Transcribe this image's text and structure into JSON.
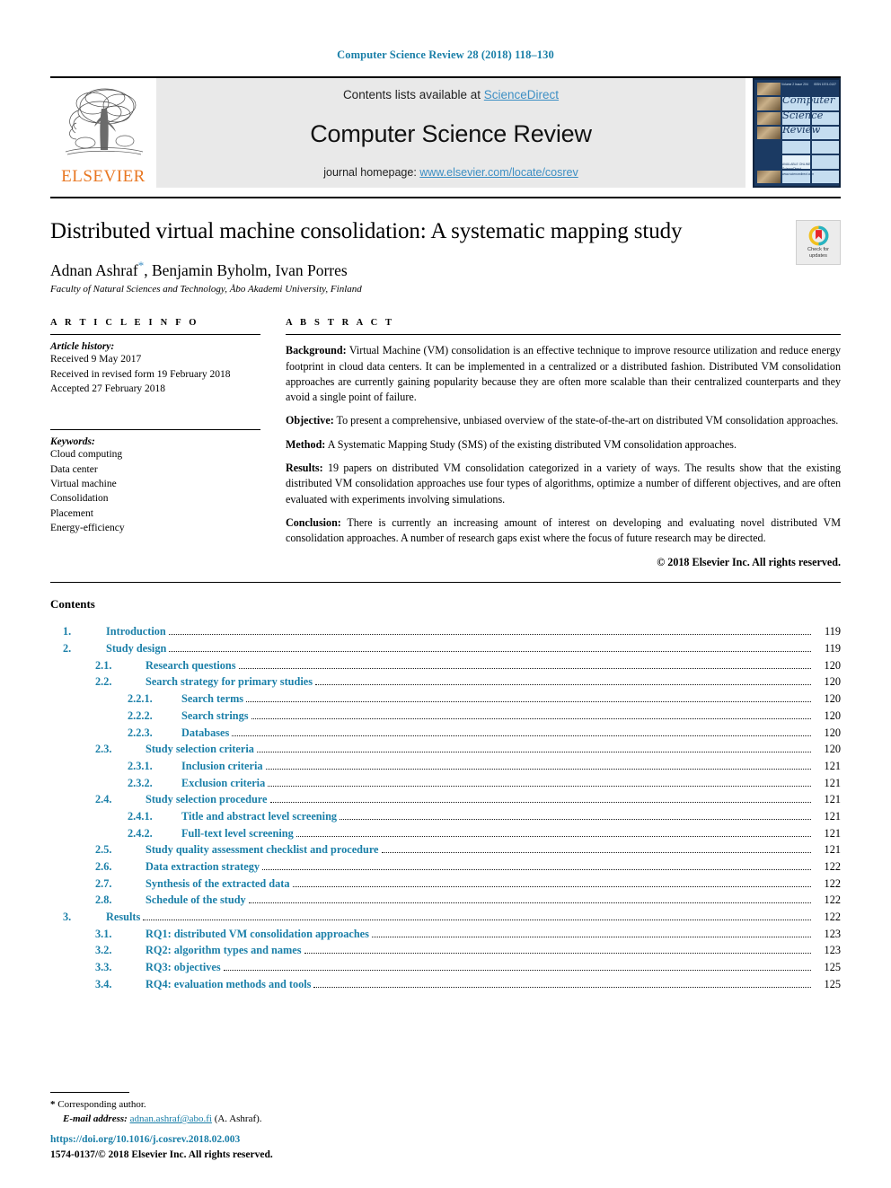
{
  "running_head": "Computer Science Review 28 (2018) 118–130",
  "masthead": {
    "publisher_wordmark": "ELSEVIER",
    "contents_prefix": "Contents lists available at ",
    "contents_link": "ScienceDirect",
    "journal_title": "Computer Science Review",
    "homepage_prefix": "journal homepage: ",
    "homepage_link": "www.elsevier.com/locate/cosrev",
    "cover": {
      "line1": "Computer",
      "line2": "Science",
      "line3": "Review",
      "top_left": "Volume 2  Issue 204",
      "top_right": "ISSN 1574-0137",
      "foot1": "AVAILABLE ONLINE",
      "foot2": "ScienceDirect",
      "foot3": "www.sciencedirect.com"
    }
  },
  "article": {
    "title": "Distributed virtual machine consolidation: A systematic mapping study",
    "authors": "Adnan Ashraf",
    "authors_rest": ", Benjamin Byholm, Ivan Porres",
    "affiliation": "Faculty of Natural Sciences and Technology, Åbo Akademi University, Finland",
    "crossmark_line1": "Check for",
    "crossmark_line2": "updates"
  },
  "article_info": {
    "heading": "A R T I C L E   I N F O",
    "history_label": "Article history:",
    "history": [
      "Received 9 May 2017",
      "Received in revised form 19 February 2018",
      "Accepted 27 February 2018"
    ],
    "keywords_label": "Keywords:",
    "keywords": [
      "Cloud computing",
      "Data center",
      "Virtual machine",
      "Consolidation",
      "Placement",
      "Energy-efficiency"
    ]
  },
  "abstract": {
    "heading": "A B S T R A C T",
    "paragraphs": [
      {
        "lead": "Background:",
        "text": " Virtual Machine (VM) consolidation is an effective technique to improve resource utilization and reduce energy footprint in cloud data centers. It can be implemented in a centralized or a distributed fashion. Distributed VM consolidation approaches are currently gaining popularity because they are often more scalable than their centralized counterparts and they avoid a single point of failure."
      },
      {
        "lead": "Objective:",
        "text": " To present a comprehensive, unbiased overview of the state-of-the-art on distributed VM consolidation approaches."
      },
      {
        "lead": "Method:",
        "text": " A Systematic Mapping Study (SMS) of the existing distributed VM consolidation approaches."
      },
      {
        "lead": "Results:",
        "text": " 19 papers on distributed VM consolidation categorized in a variety of ways. The results show that the existing distributed VM consolidation approaches use four types of algorithms, optimize a number of different objectives, and are often evaluated with experiments involving simulations."
      },
      {
        "lead": "Conclusion:",
        "text": " There is currently an increasing amount of interest on developing and evaluating novel distributed VM consolidation approaches. A number of research gaps exist where the focus of future research may be directed."
      }
    ],
    "copyright": "© 2018 Elsevier Inc. All rights reserved."
  },
  "contents": {
    "title": "Contents",
    "entries": [
      {
        "level": 1,
        "num": "1.",
        "label": "Introduction",
        "page": "119"
      },
      {
        "level": 1,
        "num": "2.",
        "label": "Study design",
        "page": "119"
      },
      {
        "level": 2,
        "num": "2.1.",
        "label": "Research questions",
        "page": "120"
      },
      {
        "level": 2,
        "num": "2.2.",
        "label": "Search strategy for primary studies",
        "page": "120"
      },
      {
        "level": 3,
        "num": "2.2.1.",
        "label": "Search terms",
        "page": "120"
      },
      {
        "level": 3,
        "num": "2.2.2.",
        "label": "Search strings",
        "page": "120"
      },
      {
        "level": 3,
        "num": "2.2.3.",
        "label": "Databases",
        "page": "120"
      },
      {
        "level": 2,
        "num": "2.3.",
        "label": "Study selection criteria",
        "page": "120"
      },
      {
        "level": 3,
        "num": "2.3.1.",
        "label": "Inclusion criteria",
        "page": "121"
      },
      {
        "level": 3,
        "num": "2.3.2.",
        "label": "Exclusion criteria",
        "page": "121"
      },
      {
        "level": 2,
        "num": "2.4.",
        "label": "Study selection procedure",
        "page": "121"
      },
      {
        "level": 3,
        "num": "2.4.1.",
        "label": "Title and abstract level screening",
        "page": "121"
      },
      {
        "level": 3,
        "num": "2.4.2.",
        "label": "Full-text level screening",
        "page": "121"
      },
      {
        "level": 2,
        "num": "2.5.",
        "label": "Study quality assessment checklist and procedure",
        "page": "121"
      },
      {
        "level": 2,
        "num": "2.6.",
        "label": "Data extraction strategy",
        "page": "122"
      },
      {
        "level": 2,
        "num": "2.7.",
        "label": "Synthesis of the extracted data",
        "page": "122"
      },
      {
        "level": 2,
        "num": "2.8.",
        "label": "Schedule of the study",
        "page": "122"
      },
      {
        "level": 1,
        "num": "3.",
        "label": "Results",
        "page": "122"
      },
      {
        "level": 2,
        "num": "3.1.",
        "label": "RQ1: distributed VM consolidation approaches",
        "page": "123"
      },
      {
        "level": 2,
        "num": "3.2.",
        "label": "RQ2: algorithm types and names",
        "page": "123"
      },
      {
        "level": 2,
        "num": "3.3.",
        "label": "RQ3: objectives",
        "page": "125"
      },
      {
        "level": 2,
        "num": "3.4.",
        "label": "RQ4: evaluation methods and tools",
        "page": "125"
      }
    ]
  },
  "footnotes": {
    "corresponding": "Corresponding author.",
    "star": "*",
    "email_label": "E-mail address:",
    "email": "adnan.ashraf@abo.fi",
    "email_owner": "(A. Ashraf).",
    "doi": "https://doi.org/10.1016/j.cosrev.2018.02.003",
    "issn": "1574-0137/© 2018 Elsevier Inc. All rights reserved."
  },
  "colors": {
    "link_blue": "#3d8fc4",
    "toc_blue": "#1a7fa8",
    "elsevier_orange": "#E87722",
    "banner_gray": "#e9e9e9"
  }
}
